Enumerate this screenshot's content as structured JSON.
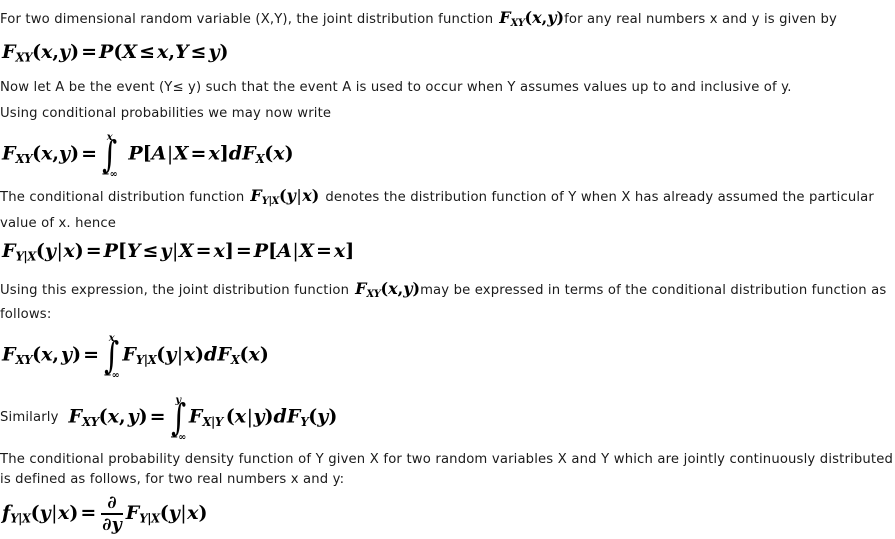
{
  "document": {
    "title": "Joint and Conditional Distribution Functions",
    "background_color": "#ffffff",
    "text_color": "#1a1a1a"
  },
  "lines": {
    "intro_a": "For two dimensional random variable (X,Y), the joint distribution function",
    "intro_b": "for any real numbers x and y is given by",
    "let_a": "Now let A be the event (Y≤ y) such that the event A is used to occur when Y assumes values up to and inclusive of y.",
    "using_cond": "Using conditional probabilities we may now write",
    "cond_def_a": "The conditional distribution function",
    "cond_def_b": "denotes the distribution function of Y when X has already assumed the particular",
    "cond_def_c": "value of x. hence",
    "expr_a": "Using this expression, the joint distribution function",
    "expr_b": "may be expressed in terms of the conditional distribution function as",
    "expr_c": "follows:",
    "similarly": "Similarly",
    "pdf_def": "The conditional probability density function of Y given X for two random variables X and Y which are jointly continuously distributed is defined as follows, for two real numbers x and y:"
  },
  "math": {
    "F": "F",
    "f": "f",
    "P": "P",
    "d": "d",
    "partial": "∂",
    "sub_XY": "XY",
    "sub_X": "X",
    "sub_Y": "Y",
    "sub_Y_given_X": "Y|X",
    "sub_X_given_Y": "X|Y",
    "paren_open": "(",
    "paren_close": ")",
    "bracket_open": "[",
    "bracket_close": "]",
    "bar": "|",
    "comma": ",",
    "equals": "=",
    "leq": "≤",
    "x": "x",
    "y": "y",
    "X": "X",
    "Y": "Y",
    "A": "A",
    "neg_infinity": "−∞",
    "integral_sign": "∫"
  },
  "equations": {
    "eq1_id": "joint-cdf-definition",
    "eq2_id": "joint-cdf-integral-conditional-event",
    "eq3_id": "conditional-cdf-definition",
    "eq4_id": "joint-cdf-integral-conditional-y-given-x",
    "eq5_id": "joint-cdf-integral-conditional-x-given-y",
    "eq6_id": "conditional-pdf-partial-derivative",
    "eq1_text": "F_XY(x,y) = P(X ≤ x, Y ≤ y)",
    "eq2_text": "F_XY(x,y) = ∫_{-∞}^{x} P[A|X = x] dF_X(x)",
    "eq3_text": "F_{Y|X}(y|x) = P[Y ≤ y | X = x] = P[A|X = x]",
    "eq4_text": "F_XY(x,y) = ∫_{-∞}^{x} F_{Y|X}(y|x) dF_X(x)",
    "eq5_text": "F_XY(x,y) = ∫_{-∞}^{y} F_{X|Y}(x|y) dF_Y(y)",
    "eq6_text": "f_{Y|X}(y|x) = ∂/∂y F_{Y|X}(y|x)"
  }
}
